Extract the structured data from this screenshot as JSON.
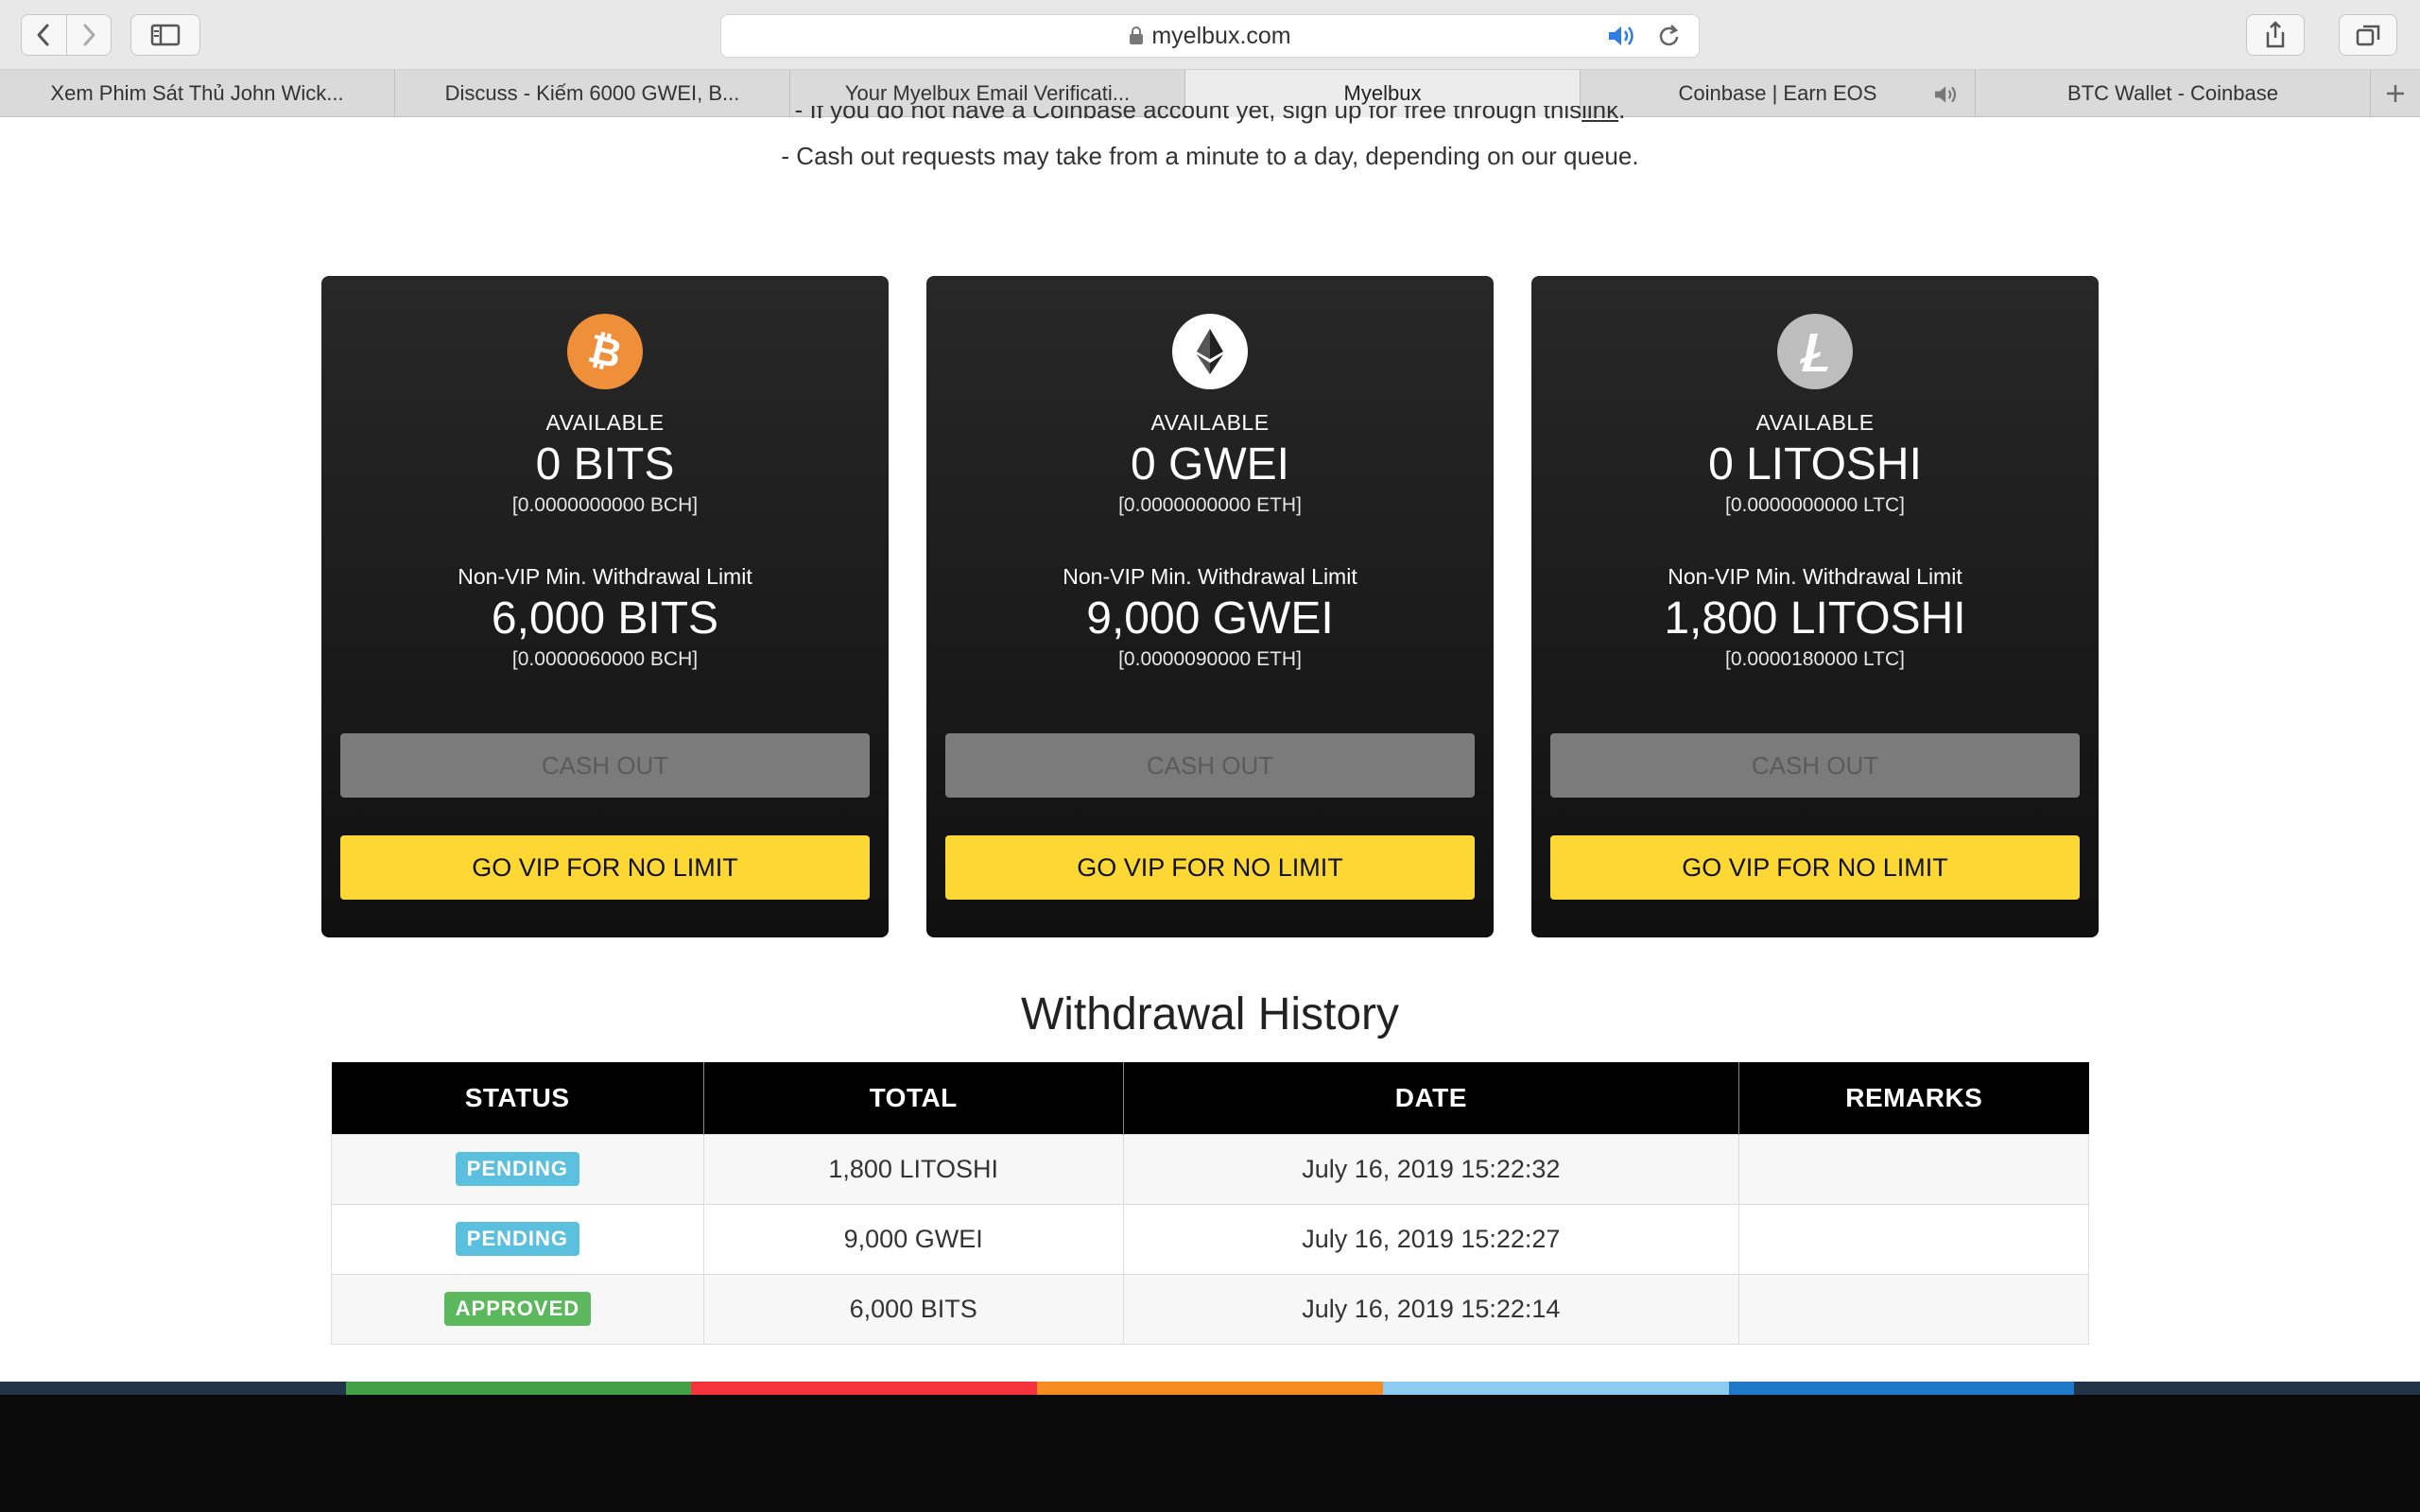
{
  "browser": {
    "url": "myelbux.com",
    "tabs": [
      {
        "label": "Xem Phim Sát Thủ John Wick..."
      },
      {
        "label": "Discuss - Kiếm 6000 GWEI, B..."
      },
      {
        "label": "Your Myelbux Email Verificati..."
      },
      {
        "label": "Myelbux"
      },
      {
        "label": "Coinbase | Earn EOS"
      },
      {
        "label": "BTC Wallet - Coinbase"
      }
    ]
  },
  "notes": {
    "line1_prefix": "- If you do not have a Coinbase account yet, sign up for free through this ",
    "line1_link": "link",
    "line1_suffix": ".",
    "line2": "- Cash out requests may take from a minute to a day, depending on our queue."
  },
  "cards": [
    {
      "icon": "bitcoin-cash-icon",
      "icon_color": "#f08f3a",
      "available_label": "AVAILABLE",
      "available_value": "0 BITS",
      "available_sub": "[0.0000000000 BCH]",
      "limit_label": "Non-VIP Min. Withdrawal Limit",
      "limit_value": "6,000 BITS",
      "limit_sub": "[0.0000060000 BCH]",
      "cash_out_label": "CASH OUT",
      "vip_label": "GO VIP FOR NO LIMIT"
    },
    {
      "icon": "ethereum-icon",
      "icon_color": "#ffffff",
      "available_label": "AVAILABLE",
      "available_value": "0 GWEI",
      "available_sub": "[0.0000000000 ETH]",
      "limit_label": "Non-VIP Min. Withdrawal Limit",
      "limit_value": "9,000 GWEI",
      "limit_sub": "[0.0000090000 ETH]",
      "cash_out_label": "CASH OUT",
      "vip_label": "GO VIP FOR NO LIMIT"
    },
    {
      "icon": "litecoin-icon",
      "icon_color": "#bdbdbd",
      "available_label": "AVAILABLE",
      "available_value": "0 LITOSHI",
      "available_sub": "[0.0000000000 LTC]",
      "limit_label": "Non-VIP Min. Withdrawal Limit",
      "limit_value": "1,800 LITOSHI",
      "limit_sub": "[0.0000180000 LTC]",
      "cash_out_label": "CASH OUT",
      "vip_label": "GO VIP FOR NO LIMIT"
    }
  ],
  "history": {
    "title": "Withdrawal History",
    "columns": [
      "STATUS",
      "TOTAL",
      "DATE",
      "REMARKS"
    ],
    "rows": [
      {
        "status": "PENDING",
        "status_color": "#5bc0de",
        "total": "1,800 LITOSHI",
        "date": "July 16, 2019 15:22:32",
        "remarks": ""
      },
      {
        "status": "PENDING",
        "status_color": "#5bc0de",
        "total": "9,000 GWEI",
        "date": "July 16, 2019 15:22:27",
        "remarks": ""
      },
      {
        "status": "APPROVED",
        "status_color": "#5cb85c",
        "total": "6,000 BITS",
        "date": "July 16, 2019 15:22:14",
        "remarks": ""
      }
    ]
  },
  "colors": {
    "vip_button": "#fdd835",
    "cash_out_disabled": "#7b7b7b",
    "stripe": [
      "#223548",
      "#43a047",
      "#f5333f",
      "#f68b1f",
      "#8ecbf0",
      "#1f78c8",
      "#223548"
    ]
  }
}
